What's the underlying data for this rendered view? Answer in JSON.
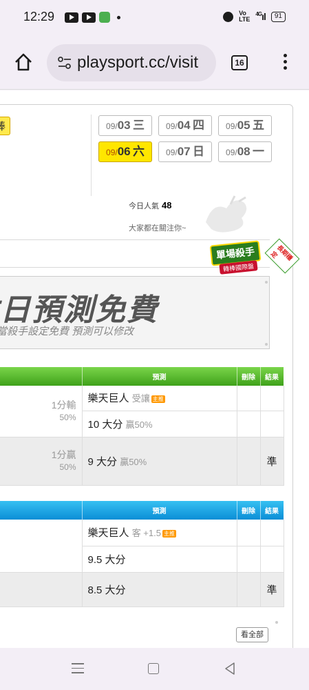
{
  "status_bar": {
    "time": "12:29",
    "network": "4G",
    "volte": "Vo\nLTE",
    "battery": "91",
    "icons": [
      "youtube-icon",
      "youtube-icon",
      "app-notification-icon",
      "dot-icon",
      "alarm-icon",
      "volte-icon",
      "signal-icon",
      "battery-icon"
    ]
  },
  "browser": {
    "url": "playsport.cc/visit",
    "tab_count": "16",
    "icons": [
      "home-icon",
      "site-settings-icon",
      "tabs-icon",
      "more-menu-icon"
    ]
  },
  "page": {
    "league_tag": "韓棒",
    "dates": [
      {
        "prefix": "09/",
        "day": "03",
        "weekday": "三",
        "active": false
      },
      {
        "prefix": "09/",
        "day": "04",
        "weekday": "四",
        "active": false
      },
      {
        "prefix": "09/",
        "day": "05",
        "weekday": "五",
        "active": false
      },
      {
        "prefix": "09/",
        "day": "06",
        "weekday": "六",
        "active": true
      },
      {
        "prefix": "09/",
        "day": "07",
        "weekday": "日",
        "active": false
      },
      {
        "prefix": "09/",
        "day": "08",
        "weekday": "一",
        "active": false
      }
    ],
    "popularity_label": "今日人氣",
    "popularity_value": "48",
    "attention_text": "大家都在關注你~",
    "badge": {
      "main": "單場殺手",
      "sub": "韓棒國際盤",
      "ribbon": "長期穩定"
    },
    "banner": {
      "title": "本日預測免費",
      "subtitle": "當殺手設定免費 預測可以修改"
    },
    "table1": {
      "headers": {
        "prediction": "預測",
        "delete": "刪除",
        "result": "結果"
      },
      "rows": [
        {
          "meta_top": "",
          "meta_bottom": "",
          "team": "樂天巨人",
          "detail": "受讓",
          "tag": "主推",
          "result": ""
        },
        {
          "meta_top": "1分輸",
          "meta_bottom": "50%",
          "team": "10 大分",
          "detail": "贏50%",
          "tag": "",
          "result": ""
        },
        {
          "meta_top": "1分贏",
          "meta_bottom": "50%",
          "team": "9 大分",
          "detail": "贏50%",
          "tag": "",
          "result": "準"
        }
      ]
    },
    "table2": {
      "headers": {
        "prediction": "預測",
        "delete": "刪除",
        "result": "結果"
      },
      "rows": [
        {
          "team": "樂天巨人",
          "detail": "客 +1.5",
          "tag": "主推",
          "result": ""
        },
        {
          "team": "9.5 大分",
          "detail": "",
          "tag": "",
          "result": ""
        },
        {
          "team": "8.5 大分",
          "detail": "",
          "tag": "",
          "result": "準"
        }
      ]
    },
    "see_all": "看全部"
  },
  "nav_bar": {
    "icons": [
      "recent-apps-icon",
      "home-nav-icon",
      "back-icon"
    ]
  }
}
